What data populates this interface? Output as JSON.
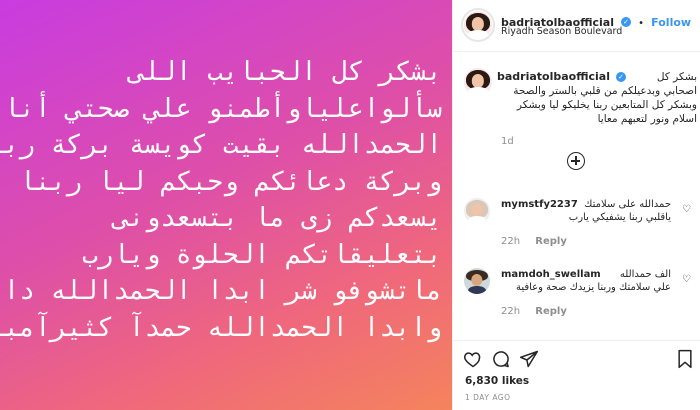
{
  "media": {
    "lines": [
      "بشكر كل الحبايب اللى",
      "سألواعلياوأطمنو علي صحتي أنا",
      "الحمدالله بقيت كويسة بركة ربنا",
      "وبركة دعائكم وحبكم ليا ربنا",
      "يسعدكم زى ما بتسعدونى",
      "بتعليقاتكم الحلوة ويارب",
      "ماتشوفو شر ابدا الحمدالله دائمآ",
      "وابدا الحمدالله حمدآ كثيرآمباركا"
    ]
  },
  "header": {
    "username": "badriatolbaofficial",
    "follow_label": "Follow",
    "separator": "•",
    "location": "Riyadh Season Boulevard"
  },
  "caption": {
    "username": "badriatolbaofficial",
    "text": "بشكر كل اصحابي وبدعيلكم من قلبي بالستر والصحة وبشكر كل المتابعين ربنا يخليكو ليا وبشكر اسلام ونور لتعبهم معايا",
    "time": "1d"
  },
  "comments": [
    {
      "username": "mymstfy2237",
      "text": "حمدالله على سلامتك ياقلبي ربنا يشفيكي يارب",
      "time": "22h",
      "reply_label": "Reply"
    },
    {
      "username": "mamdoh_swellam",
      "text": "الف حمدالله علي سلامتك وربنا يزيدك صحة وعافية",
      "time": "22h",
      "reply_label": "Reply"
    }
  ],
  "actions": {
    "likes": "6,830 likes",
    "date": "1 DAY AGO"
  },
  "colors": {
    "accent": "#3897f0",
    "gradient_start": "#c93ce0",
    "gradient_end": "#f4845c"
  }
}
